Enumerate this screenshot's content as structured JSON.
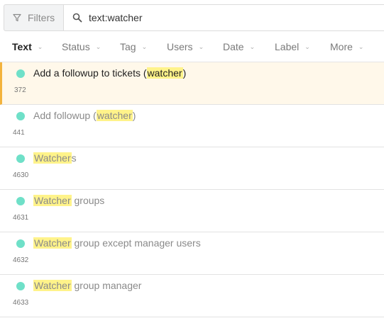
{
  "filters": {
    "label": "Filters"
  },
  "search": {
    "value": "text:watcher",
    "placeholder": ""
  },
  "facets": [
    {
      "label": "Text",
      "active": true
    },
    {
      "label": "Status",
      "active": false
    },
    {
      "label": "Tag",
      "active": false
    },
    {
      "label": "Users",
      "active": false
    },
    {
      "label": "Date",
      "active": false
    },
    {
      "label": "Label",
      "active": false
    },
    {
      "label": "More",
      "active": false
    }
  ],
  "colors": {
    "accent": "#f3b33d",
    "status_dot": "#6fe0c8",
    "highlight": "#fff38a"
  },
  "results": [
    {
      "prefix": "Add a followup to tickets (",
      "match": "watcher",
      "suffix": ")",
      "id": "372",
      "selected": true
    },
    {
      "prefix": "Add followup (",
      "match": "watcher",
      "suffix": ")",
      "id": "441",
      "selected": false
    },
    {
      "prefix": "",
      "match": "Watcher",
      "suffix": "s",
      "id": "4630",
      "selected": false
    },
    {
      "prefix": "",
      "match": "Watcher",
      "suffix": " groups",
      "id": "4631",
      "selected": false
    },
    {
      "prefix": "",
      "match": "Watcher",
      "suffix": " group except manager users",
      "id": "4632",
      "selected": false
    },
    {
      "prefix": "",
      "match": "Watcher",
      "suffix": " group manager",
      "id": "4633",
      "selected": false
    }
  ]
}
